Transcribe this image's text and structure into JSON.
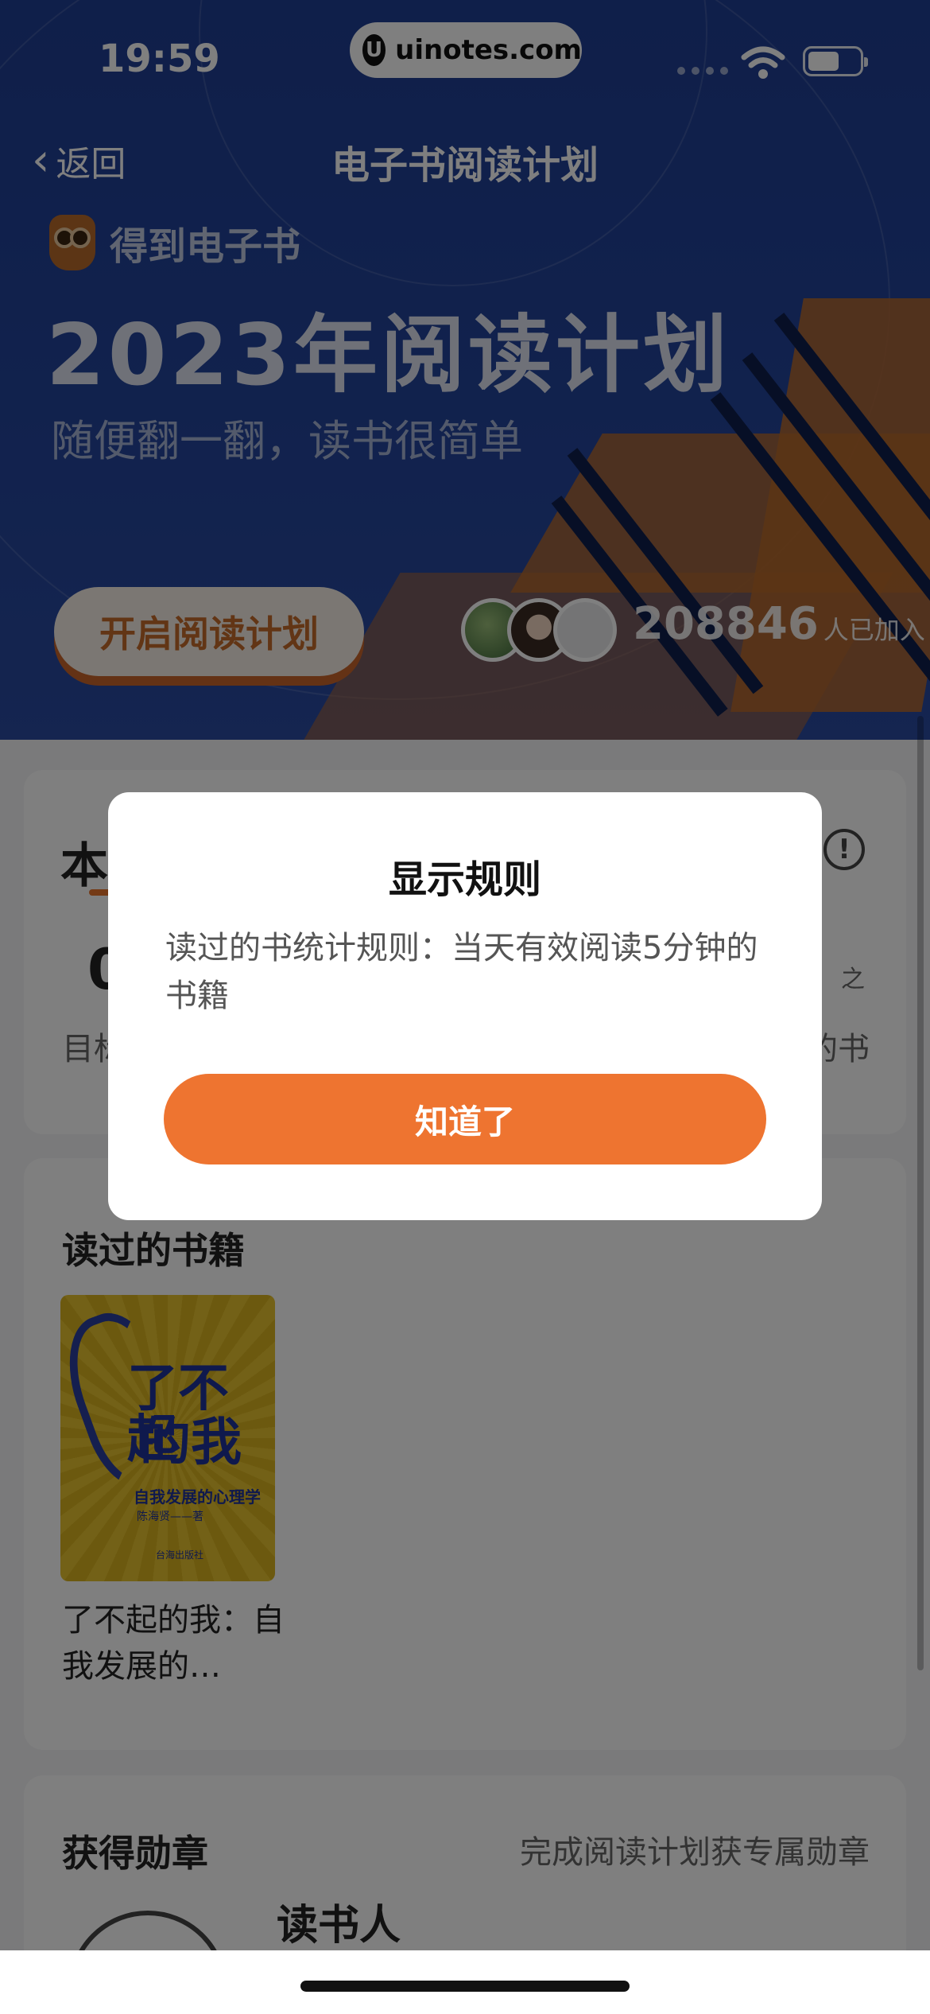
{
  "status_bar": {
    "time": "19:59",
    "url": "uinotes.com",
    "url_logo_glyph": "U"
  },
  "nav": {
    "back_label": "返回",
    "title": "电子书阅读计划"
  },
  "banner": {
    "brand_name": "得到电子书",
    "hero_title": "2023年阅读计划",
    "hero_subtitle": "随便翻一翻，读书很简单",
    "start_button": "开启阅读计划",
    "joined_count": "208846",
    "joined_suffix": "人已加入"
  },
  "plan_card": {
    "heading": "本",
    "info_glyph": "!",
    "value_left": "0",
    "label_left": "目标",
    "value_right_fragment": "之",
    "label_right": "的书"
  },
  "books_card": {
    "title": "读过的书籍",
    "book_name": "了不起的我：自我发展的…",
    "cover": {
      "line1": "了不起",
      "line2": "的我",
      "subtitle": "自我发展的心理学",
      "author": "陈海贤——著",
      "publisher": "台海出版社"
    }
  },
  "medals_card": {
    "title": "获得勋章",
    "hint": "完成阅读计划获专属勋章",
    "medal_name": "读书人"
  },
  "dialog": {
    "title": "显示规则",
    "body": "读过的书统计规则：当天有效阅读5分钟的书籍",
    "confirm_button": "知道了"
  },
  "colors": {
    "accent_orange": "#ee7430",
    "banner_blue": "#23449b"
  }
}
